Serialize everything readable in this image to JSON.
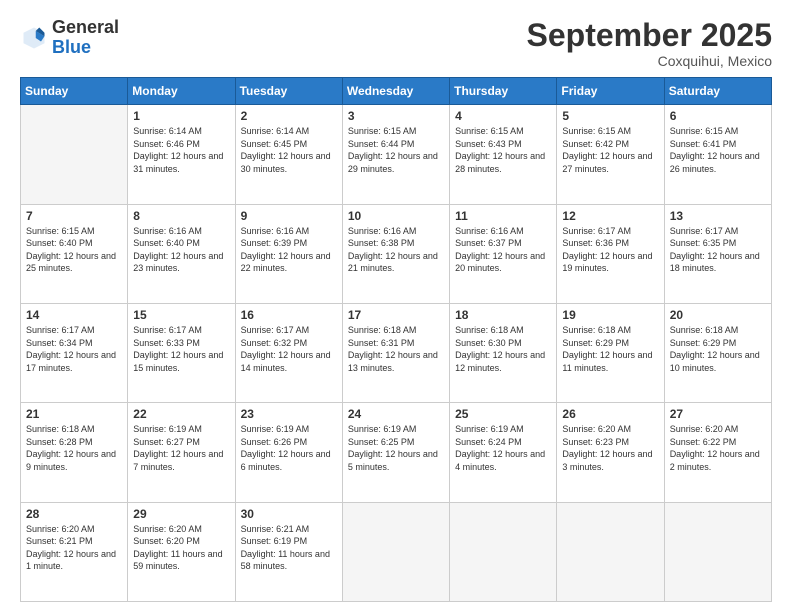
{
  "header": {
    "logo": {
      "general": "General",
      "blue": "Blue"
    },
    "title": "September 2025",
    "location": "Coxquihui, Mexico"
  },
  "weekdays": [
    "Sunday",
    "Monday",
    "Tuesday",
    "Wednesday",
    "Thursday",
    "Friday",
    "Saturday"
  ],
  "weeks": [
    [
      {
        "day": "",
        "empty": true
      },
      {
        "day": "1",
        "sunrise": "Sunrise: 6:14 AM",
        "sunset": "Sunset: 6:46 PM",
        "daylight": "Daylight: 12 hours and 31 minutes."
      },
      {
        "day": "2",
        "sunrise": "Sunrise: 6:14 AM",
        "sunset": "Sunset: 6:45 PM",
        "daylight": "Daylight: 12 hours and 30 minutes."
      },
      {
        "day": "3",
        "sunrise": "Sunrise: 6:15 AM",
        "sunset": "Sunset: 6:44 PM",
        "daylight": "Daylight: 12 hours and 29 minutes."
      },
      {
        "day": "4",
        "sunrise": "Sunrise: 6:15 AM",
        "sunset": "Sunset: 6:43 PM",
        "daylight": "Daylight: 12 hours and 28 minutes."
      },
      {
        "day": "5",
        "sunrise": "Sunrise: 6:15 AM",
        "sunset": "Sunset: 6:42 PM",
        "daylight": "Daylight: 12 hours and 27 minutes."
      },
      {
        "day": "6",
        "sunrise": "Sunrise: 6:15 AM",
        "sunset": "Sunset: 6:41 PM",
        "daylight": "Daylight: 12 hours and 26 minutes."
      }
    ],
    [
      {
        "day": "7",
        "sunrise": "Sunrise: 6:15 AM",
        "sunset": "Sunset: 6:40 PM",
        "daylight": "Daylight: 12 hours and 25 minutes."
      },
      {
        "day": "8",
        "sunrise": "Sunrise: 6:16 AM",
        "sunset": "Sunset: 6:40 PM",
        "daylight": "Daylight: 12 hours and 23 minutes."
      },
      {
        "day": "9",
        "sunrise": "Sunrise: 6:16 AM",
        "sunset": "Sunset: 6:39 PM",
        "daylight": "Daylight: 12 hours and 22 minutes."
      },
      {
        "day": "10",
        "sunrise": "Sunrise: 6:16 AM",
        "sunset": "Sunset: 6:38 PM",
        "daylight": "Daylight: 12 hours and 21 minutes."
      },
      {
        "day": "11",
        "sunrise": "Sunrise: 6:16 AM",
        "sunset": "Sunset: 6:37 PM",
        "daylight": "Daylight: 12 hours and 20 minutes."
      },
      {
        "day": "12",
        "sunrise": "Sunrise: 6:17 AM",
        "sunset": "Sunset: 6:36 PM",
        "daylight": "Daylight: 12 hours and 19 minutes."
      },
      {
        "day": "13",
        "sunrise": "Sunrise: 6:17 AM",
        "sunset": "Sunset: 6:35 PM",
        "daylight": "Daylight: 12 hours and 18 minutes."
      }
    ],
    [
      {
        "day": "14",
        "sunrise": "Sunrise: 6:17 AM",
        "sunset": "Sunset: 6:34 PM",
        "daylight": "Daylight: 12 hours and 17 minutes."
      },
      {
        "day": "15",
        "sunrise": "Sunrise: 6:17 AM",
        "sunset": "Sunset: 6:33 PM",
        "daylight": "Daylight: 12 hours and 15 minutes."
      },
      {
        "day": "16",
        "sunrise": "Sunrise: 6:17 AM",
        "sunset": "Sunset: 6:32 PM",
        "daylight": "Daylight: 12 hours and 14 minutes."
      },
      {
        "day": "17",
        "sunrise": "Sunrise: 6:18 AM",
        "sunset": "Sunset: 6:31 PM",
        "daylight": "Daylight: 12 hours and 13 minutes."
      },
      {
        "day": "18",
        "sunrise": "Sunrise: 6:18 AM",
        "sunset": "Sunset: 6:30 PM",
        "daylight": "Daylight: 12 hours and 12 minutes."
      },
      {
        "day": "19",
        "sunrise": "Sunrise: 6:18 AM",
        "sunset": "Sunset: 6:29 PM",
        "daylight": "Daylight: 12 hours and 11 minutes."
      },
      {
        "day": "20",
        "sunrise": "Sunrise: 6:18 AM",
        "sunset": "Sunset: 6:29 PM",
        "daylight": "Daylight: 12 hours and 10 minutes."
      }
    ],
    [
      {
        "day": "21",
        "sunrise": "Sunrise: 6:18 AM",
        "sunset": "Sunset: 6:28 PM",
        "daylight": "Daylight: 12 hours and 9 minutes."
      },
      {
        "day": "22",
        "sunrise": "Sunrise: 6:19 AM",
        "sunset": "Sunset: 6:27 PM",
        "daylight": "Daylight: 12 hours and 7 minutes."
      },
      {
        "day": "23",
        "sunrise": "Sunrise: 6:19 AM",
        "sunset": "Sunset: 6:26 PM",
        "daylight": "Daylight: 12 hours and 6 minutes."
      },
      {
        "day": "24",
        "sunrise": "Sunrise: 6:19 AM",
        "sunset": "Sunset: 6:25 PM",
        "daylight": "Daylight: 12 hours and 5 minutes."
      },
      {
        "day": "25",
        "sunrise": "Sunrise: 6:19 AM",
        "sunset": "Sunset: 6:24 PM",
        "daylight": "Daylight: 12 hours and 4 minutes."
      },
      {
        "day": "26",
        "sunrise": "Sunrise: 6:20 AM",
        "sunset": "Sunset: 6:23 PM",
        "daylight": "Daylight: 12 hours and 3 minutes."
      },
      {
        "day": "27",
        "sunrise": "Sunrise: 6:20 AM",
        "sunset": "Sunset: 6:22 PM",
        "daylight": "Daylight: 12 hours and 2 minutes."
      }
    ],
    [
      {
        "day": "28",
        "sunrise": "Sunrise: 6:20 AM",
        "sunset": "Sunset: 6:21 PM",
        "daylight": "Daylight: 12 hours and 1 minute."
      },
      {
        "day": "29",
        "sunrise": "Sunrise: 6:20 AM",
        "sunset": "Sunset: 6:20 PM",
        "daylight": "Daylight: 11 hours and 59 minutes."
      },
      {
        "day": "30",
        "sunrise": "Sunrise: 6:21 AM",
        "sunset": "Sunset: 6:19 PM",
        "daylight": "Daylight: 11 hours and 58 minutes."
      },
      {
        "day": "",
        "empty": true
      },
      {
        "day": "",
        "empty": true
      },
      {
        "day": "",
        "empty": true
      },
      {
        "day": "",
        "empty": true
      }
    ]
  ]
}
